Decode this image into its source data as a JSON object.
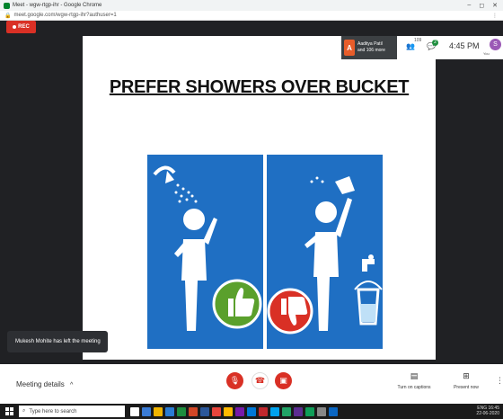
{
  "browser": {
    "title": "Meet - wgw-rtgp-ihr - Google Chrome",
    "url": "meet.google.com/wgw-rtgp-ihr?authuser=1"
  },
  "meet": {
    "rec_label": "REC",
    "participant_name": "Aaditya Patil",
    "participant_more": "and 106 more",
    "participants_count": "109",
    "chat_badge": "2",
    "clock": "4:45 PM",
    "you_initial": "S",
    "you_label": "You",
    "toast": "Mukesh Mohite has left the meeting",
    "meeting_details": "Meeting details",
    "captions_label": "Turn on captions",
    "present_label": "Present now"
  },
  "slide": {
    "title": "PREFER SHOWERS OVER BUCKET"
  },
  "taskbar": {
    "search_placeholder": "Type here to search",
    "time": "16:45",
    "date": "22-06-2020",
    "lang": "ENG"
  },
  "colors": {
    "panel_blue": "#1f6fc3",
    "thumbs_up": "#5aa02c",
    "thumbs_down": "#d93025",
    "meet_red": "#d93025"
  }
}
